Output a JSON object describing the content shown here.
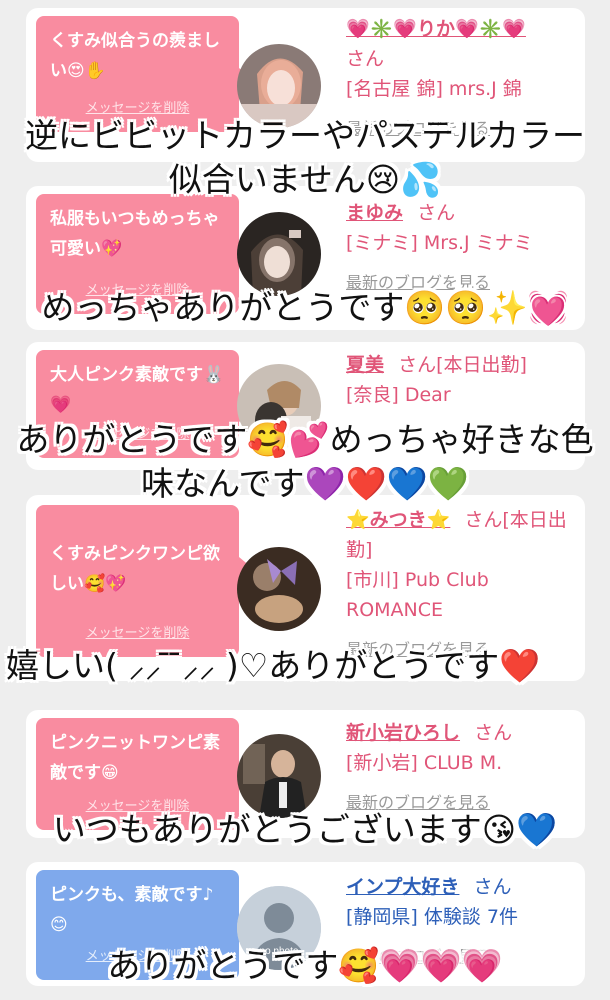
{
  "colors": {
    "background": "#eeeeee",
    "card": "#ffffff",
    "bubble_pink": "#f98ca0",
    "bubble_blue": "#7fa9ec",
    "name_pink": "#e05578",
    "name_blue": "#2d5fb8",
    "link_gray": "#999999"
  },
  "comments": [
    {
      "bubble_text": "くすみ似合うの羨ましい😍✋",
      "delete_label": "メッセージを削除",
      "bubble_color": "pink",
      "avatar_icon": "profile-photo",
      "name": "💗✳️💗りか💗✳️💗",
      "honorific": "さん",
      "shop": "[名古屋 錦] mrs.J 錦",
      "blog_link": "最新のブログを見る"
    },
    {
      "bubble_text": "私服もいつもめっちゃ可愛い💖",
      "delete_label": "メッセージを削除",
      "bubble_color": "pink",
      "avatar_icon": "profile-photo",
      "name": "まゆみ",
      "honorific": "さん",
      "shop": "[ミナミ] Mrs.J ミナミ",
      "blog_link": "最新のブログを見る"
    },
    {
      "bubble_text": "大人ピンク素敵です🐰💗",
      "delete_label": "メッセージを削除",
      "bubble_color": "pink",
      "avatar_icon": "profile-photo",
      "name": "夏美",
      "honorific": "さん[本日出勤]",
      "shop": "[奈良] Dear",
      "blog_link": "最新のブログを見る"
    },
    {
      "bubble_text": "くすみピンクワンピ欲しい🥰💖",
      "delete_label": "メッセージを削除",
      "bubble_color": "pink",
      "avatar_icon": "profile-photo",
      "name": "⭐みつき⭐",
      "honorific": "さん[本日出勤]",
      "shop": "[市川] Pub Club ROMANCE",
      "blog_link": "最新のブログを見る"
    },
    {
      "bubble_text": "ピンクニットワンピ素敵です😁",
      "delete_label": "メッセージを削除",
      "bubble_color": "pink",
      "avatar_icon": "profile-photo",
      "name": "新小岩ひろし",
      "honorific": "さん",
      "shop": "[新小岩] CLUB M.",
      "blog_link": "最新のブログを見る"
    },
    {
      "bubble_text": "ピンクも、素敵です♪😊",
      "delete_label": "メッセージを削除",
      "bubble_color": "blue",
      "avatar_icon": "no-photo-silhouette",
      "avatar_label": "no photo",
      "name": "インプ大好き",
      "honorific": "さん",
      "shop": "[静岡県] 体験談 7件",
      "blog_link": "最新のブログを見る"
    }
  ],
  "overlays": [
    "逆にビビットカラーやパステルカラー似合いません😢💦",
    "めっちゃありがとうです🥺🥺✨💓",
    "ありがとうです🥰💕めっちゃ好きな色味なんです💜❤️💙💚",
    "嬉しい( ⸝⸝ ̄ ̄⸝⸝ )♡ありがとうです❤️",
    "いつもありがとうございます😘💙",
    "ありがとうです🥰💗💗💗"
  ]
}
